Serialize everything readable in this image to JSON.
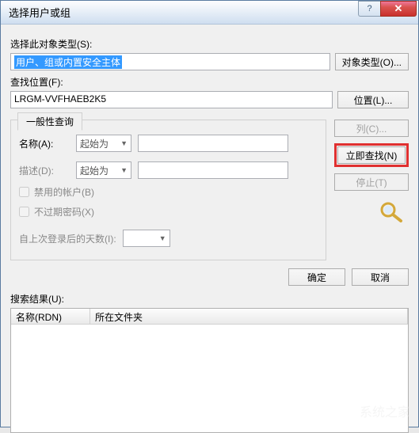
{
  "titlebar": {
    "title": "选择用户或组"
  },
  "object_type": {
    "label": "选择此对象类型(S):",
    "value": "用户、组或内置安全主体",
    "button": "对象类型(O)..."
  },
  "location": {
    "label": "查找位置(F):",
    "value": "LRGM-VVFHAEB2K5",
    "button": "位置(L)..."
  },
  "query": {
    "tab": "一般性查询",
    "name_label": "名称(A):",
    "name_op": "起始为",
    "desc_label": "描述(D):",
    "desc_op": "起始为",
    "chk_disabled": "禁用的帐户(B)",
    "chk_noexpire": "不过期密码(X)",
    "days_label": "自上次登录后的天数(I):"
  },
  "side": {
    "columns": "列(C)...",
    "findnow": "立即查找(N)",
    "stop": "停止(T)"
  },
  "okcancel": {
    "ok": "确定",
    "cancel": "取消"
  },
  "results": {
    "label": "搜索结果(U):",
    "col_name": "名称(RDN)",
    "col_folder": "所在文件夹"
  },
  "watermark": "系统之家"
}
